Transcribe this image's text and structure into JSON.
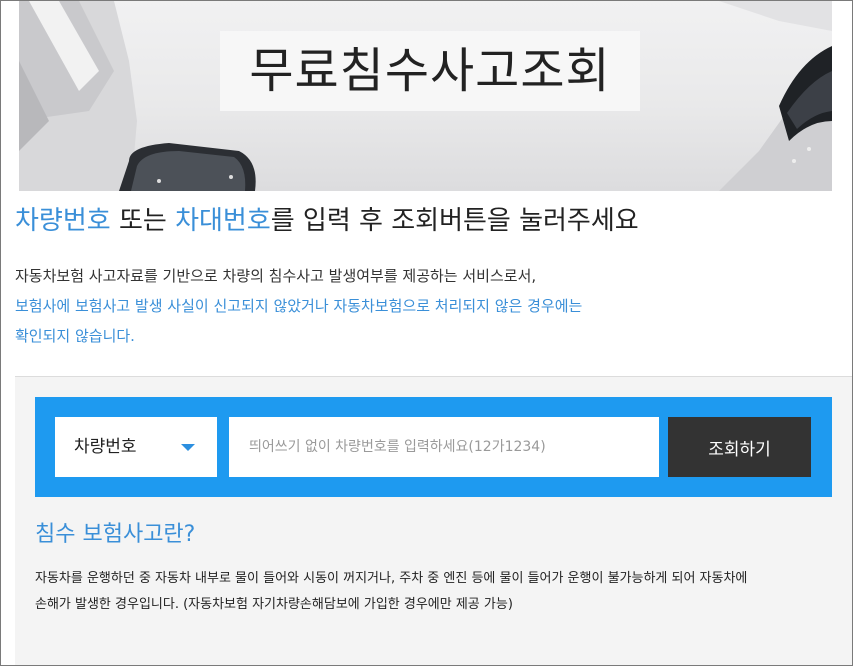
{
  "hero": {
    "title": "무료침수사고조회"
  },
  "intro": {
    "headline_part1": "차량번호",
    "headline_part2": " 또는 ",
    "headline_part3": "차대번호",
    "headline_part4": "를 입력 후 조회버튼을 눌러주세요",
    "desc_line1": "자동차보험 사고자료를 기반으로 차량의 침수사고 발생여부를 제공하는 서비스로서,",
    "desc_line2": "보험사에 보험사고 발생 사실이 신고되지 않았거나 자동차보험으로 처리되지 않은 경우에는",
    "desc_line3": "확인되지 않습니다."
  },
  "search": {
    "select_value": "차량번호",
    "input_placeholder": "띄어쓰기 없이 차량번호를 입력하세요(12가1234)",
    "button_label": "조회하기"
  },
  "info": {
    "title": "침수 보험사고란?",
    "line1": "자동차를 운행하던 중 자동차 내부로 물이 들어와 시동이 꺼지거나, 주차 중 엔진 등에 물이 들어가 운행이 불가능하게 되어 자동차에",
    "line2": "손해가 발생한 경우입니다. (자동차보험 자기차량손해담보에 가입한 경우에만 제공 가능)"
  },
  "colors": {
    "accent": "#3a8fd8",
    "search_bar": "#1e9af0",
    "button": "#333333",
    "panel": "#f4f4f4"
  },
  "icons": {
    "select_caret": "caret-down-icon"
  }
}
